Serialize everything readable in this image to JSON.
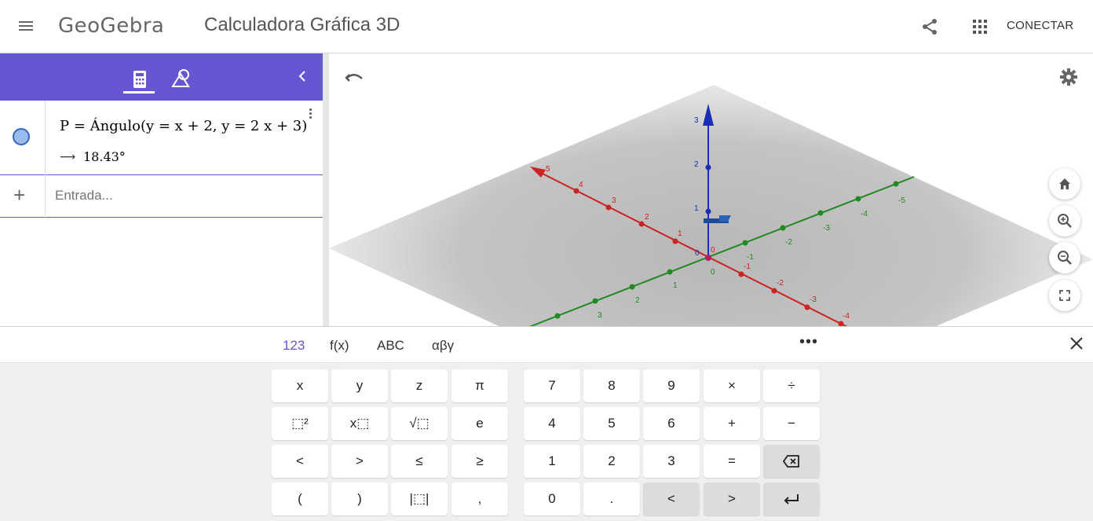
{
  "header": {
    "logo": "GeoGebra",
    "title": "Calculadora Gráfica 3D",
    "connect_label": "CONECTAR"
  },
  "algebra": {
    "row": {
      "definition": "P = Ángulo(y = x + 2, y = 2 x + 3)",
      "value_arrow": "⟶",
      "value": "18.43°",
      "marker_color": "#99bbee"
    },
    "input_placeholder": "Entrada...",
    "toolbar_color": "#6557d2"
  },
  "graphics": {
    "red_axis_labels": [
      "5",
      "4",
      "3",
      "2",
      "1",
      "0",
      "-1",
      "-2",
      "-3",
      "-4"
    ],
    "green_axis_labels": [
      "-5",
      "-4",
      "-3",
      "-2",
      "-1",
      "0",
      "1",
      "2",
      "3"
    ],
    "blue_axis_labels": [
      "3",
      "2",
      "1",
      "0"
    ]
  },
  "keyboard": {
    "tabs": [
      "123",
      "f(x)",
      "ABC",
      "αβγ"
    ],
    "more_label": "•••",
    "keys": {
      "x": "x",
      "y": "y",
      "z": "z",
      "pi": "π",
      "sq": "⬚²",
      "pow": "x⬚",
      "sqrt": "√⬚",
      "e": "e",
      "lt": "<",
      "gt": ">",
      "le": "≤",
      "ge": "≥",
      "lparen": "(",
      "rparen": ")",
      "abs": "|⬚|",
      "comma": ",",
      "n7": "7",
      "n8": "8",
      "n9": "9",
      "times": "×",
      "divide": "÷",
      "n4": "4",
      "n5": "5",
      "n6": "6",
      "plus": "+",
      "minus": "−",
      "n1": "1",
      "n2": "2",
      "n3": "3",
      "equals": "=",
      "n0": "0",
      "dot": ".",
      "left": "<",
      "right": ">"
    }
  }
}
